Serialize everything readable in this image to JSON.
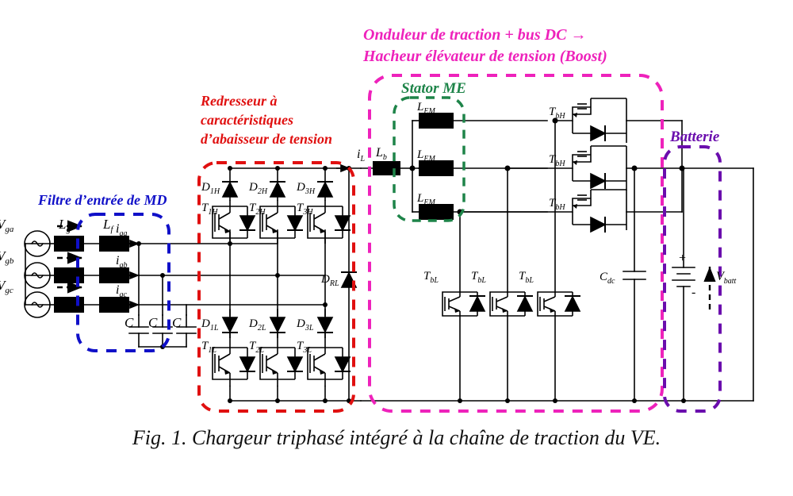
{
  "figure": {
    "caption": "Fig. 1. Chargeur triphasé intégré à la chaîne de traction du VE."
  },
  "colors": {
    "input_filter": "#1010c8",
    "rectifier": "#e01010",
    "inverter": "#ee22bb",
    "stator": "#1e8449",
    "battery": "#6a0dad",
    "wire": "#000000",
    "background": "#ffffff"
  },
  "annotations": {
    "inverter_title_line1": "Onduleur de traction + bus DC   →",
    "inverter_title_line2": "Hacheur élévateur de tension (Boost)",
    "stator_title": "Stator ME",
    "rectifier_title_line1": "Redresseur à",
    "rectifier_title_line2": "caractéristiques",
    "rectifier_title_line3": "d’abaisseur de tension",
    "filter_title": "Filtre d’entrée de MD",
    "battery_title": "Batterie"
  },
  "sources": [
    {
      "name": "source-phase-a",
      "label": "V",
      "sub": "ga"
    },
    {
      "name": "source-phase-b",
      "label": "V",
      "sub": "gb"
    },
    {
      "name": "source-phase-c",
      "label": "V",
      "sub": "gc"
    }
  ],
  "grid_inductors": {
    "label": "L",
    "sub": "g",
    "count": 3
  },
  "filter_inductors": {
    "label": "L",
    "sub": "f",
    "count": 3
  },
  "line_currents": [
    {
      "label": "i",
      "sub": "ga"
    },
    {
      "label": "i",
      "sub": "gb"
    },
    {
      "label": "i",
      "sub": "gc"
    }
  ],
  "filter_caps": {
    "label": "C",
    "count": 3
  },
  "rectifier": {
    "upper_diodes": [
      {
        "label": "D",
        "sub": "1H"
      },
      {
        "label": "D",
        "sub": "2H"
      },
      {
        "label": "D",
        "sub": "3H"
      }
    ],
    "upper_switches": [
      {
        "label": "T",
        "sub": "1H"
      },
      {
        "label": "T",
        "sub": "2H"
      },
      {
        "label": "T",
        "sub": "3H"
      }
    ],
    "lower_diodes": [
      {
        "label": "D",
        "sub": "1L"
      },
      {
        "label": "D",
        "sub": "2L"
      },
      {
        "label": "D",
        "sub": "3L"
      }
    ],
    "lower_switches": [
      {
        "label": "T",
        "sub": "1L"
      },
      {
        "label": "T",
        "sub": "2L"
      },
      {
        "label": "T",
        "sub": "3L"
      }
    ],
    "freewheel_diode": {
      "label": "D",
      "sub": "RL"
    }
  },
  "dc_link": {
    "current": {
      "label": "i",
      "sub": "L"
    },
    "boost_inductor": {
      "label": "L",
      "sub": "b"
    }
  },
  "stator": {
    "inductors": [
      {
        "label": "L",
        "sub": "EM"
      },
      {
        "label": "L",
        "sub": "EM"
      },
      {
        "label": "L",
        "sub": "EM"
      }
    ]
  },
  "inverter": {
    "high_switches": [
      {
        "label": "T",
        "sub": "bH"
      },
      {
        "label": "T",
        "sub": "bH"
      },
      {
        "label": "T",
        "sub": "bH"
      }
    ],
    "low_switches": [
      {
        "label": "T",
        "sub": "bL"
      },
      {
        "label": "T",
        "sub": "bL"
      },
      {
        "label": "T",
        "sub": "bL"
      }
    ]
  },
  "battery": {
    "dc_cap": {
      "label": "C",
      "sub": "dc"
    },
    "voltage": {
      "label": "V",
      "sub": "batt"
    },
    "plus": "+",
    "minus": "-"
  }
}
